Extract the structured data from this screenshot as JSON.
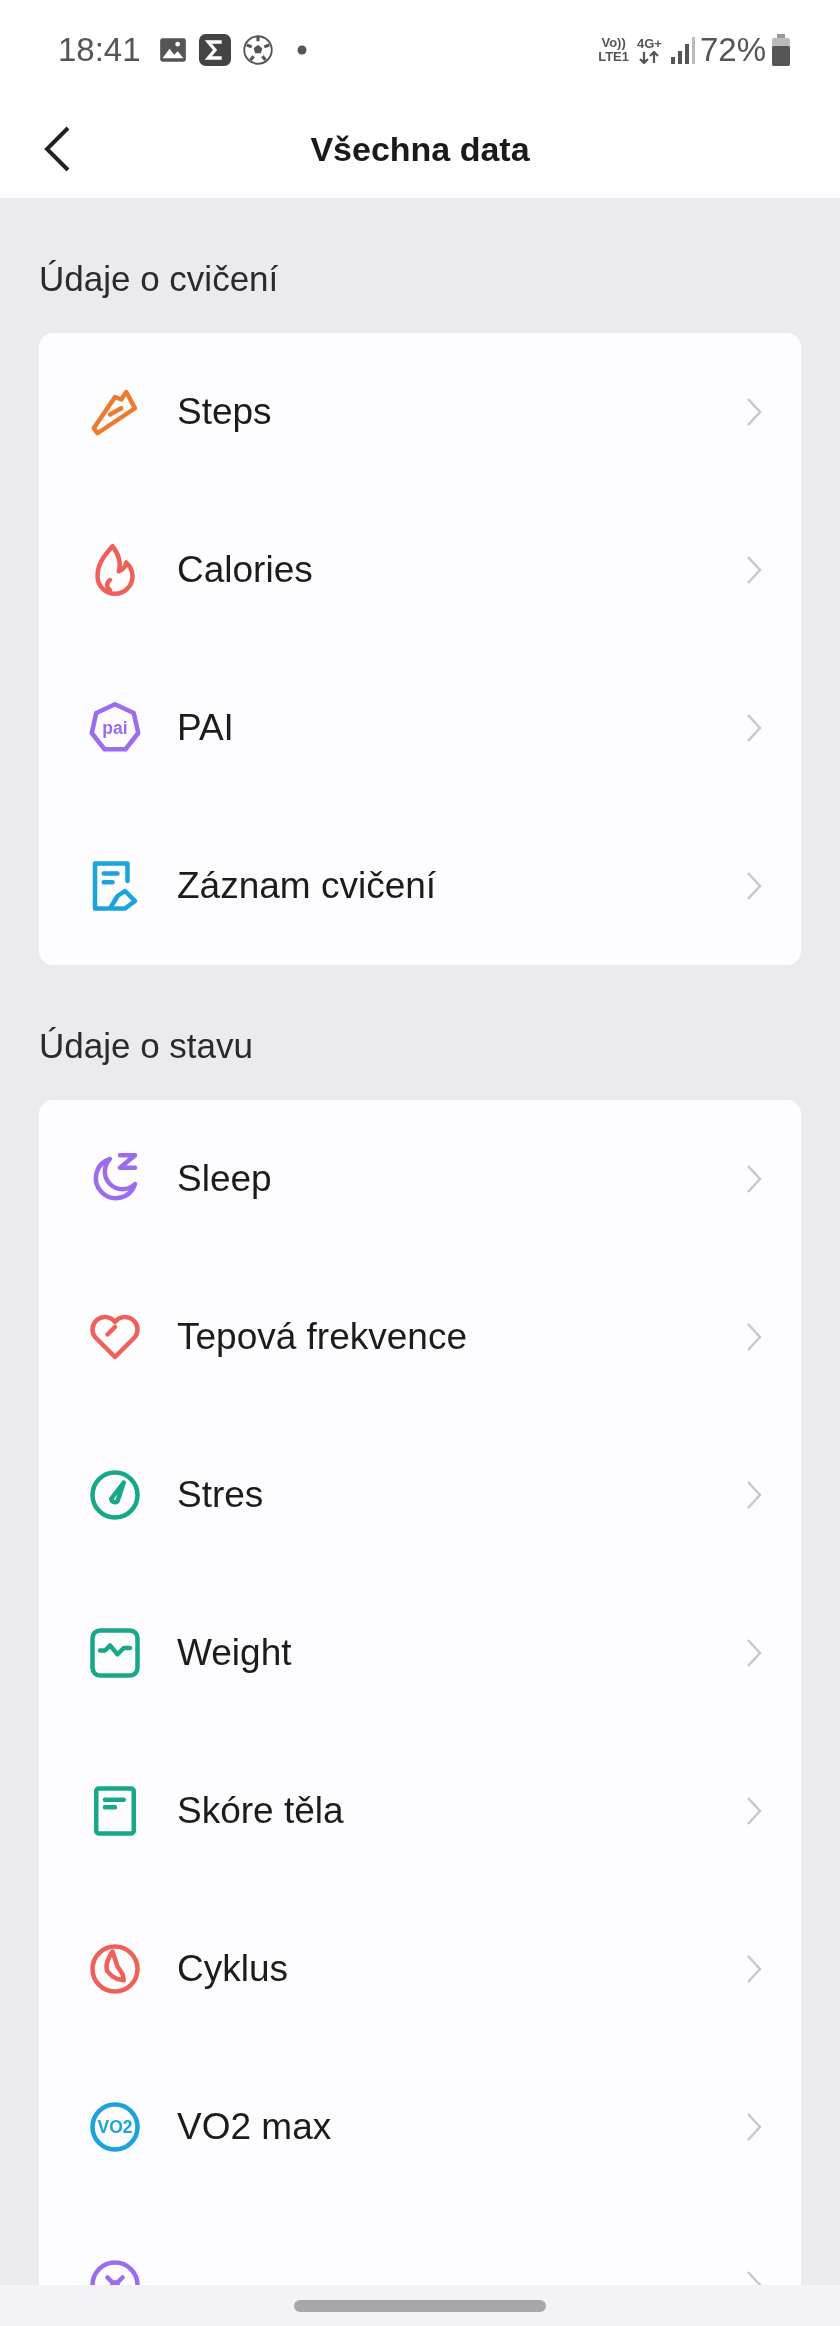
{
  "status_bar": {
    "time": "18:41",
    "volte": "Vo))",
    "volte_sub": "LTE1",
    "network": "4G+",
    "battery": "72%"
  },
  "header": {
    "title": "Všechna data"
  },
  "sections": [
    {
      "title": "Údaje o cvičení",
      "items": [
        {
          "label": "Steps",
          "kind": "steps"
        },
        {
          "label": "Calories",
          "kind": "calories"
        },
        {
          "label": "PAI",
          "kind": "pai",
          "badge": "pai"
        },
        {
          "label": "Záznam cvičení",
          "kind": "record"
        }
      ]
    },
    {
      "title": "Údaje o stavu",
      "items": [
        {
          "label": "Sleep",
          "kind": "sleep"
        },
        {
          "label": "Tepová frekvence",
          "kind": "heart"
        },
        {
          "label": "Stres",
          "kind": "stress"
        },
        {
          "label": "Weight",
          "kind": "weight"
        },
        {
          "label": "Skóre těla",
          "kind": "body"
        },
        {
          "label": "Cyklus",
          "kind": "cycle"
        },
        {
          "label": "VO2 max",
          "kind": "vo2",
          "badge": "VO2"
        },
        {
          "kind": "capacity"
        }
      ]
    }
  ]
}
